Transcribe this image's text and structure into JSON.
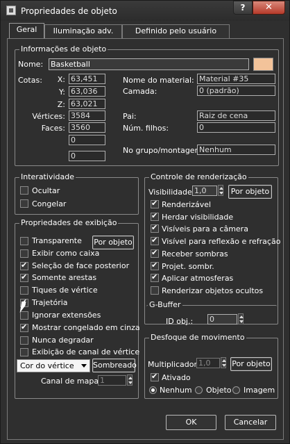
{
  "window": {
    "title": "Propriedades de objeto",
    "help": "?",
    "close": "✕"
  },
  "tabs": [
    {
      "label": "Geral"
    },
    {
      "label": "Iluminação adv."
    },
    {
      "label": "Definido pelo usuário"
    }
  ],
  "info": {
    "title": "Informações de objeto",
    "name_label": "Nome:",
    "name_value": "Basketball",
    "swatch_color": "#f3c39a",
    "cotas_label": "Cotas:",
    "x_label": "X:",
    "x_value": "63,451",
    "y_label": "Y:",
    "y_value": "63,036",
    "z_label": "Z:",
    "z_value": "63,021",
    "vertices_label": "Vértices:",
    "vertices_value": "3584",
    "faces_label": "Faces:",
    "faces_value": "3560",
    "extra1_value": "0",
    "extra2_value": "0",
    "material_label": "Nome do material:",
    "material_value": "Material #35",
    "camada_label": "Camada:",
    "camada_value": "0 (padrão)",
    "pai_label": "Pai:",
    "pai_value": "Raiz de cena",
    "filhos_label": "Núm. filhos:",
    "filhos_value": "0",
    "grupo_label": "No grupo/montagem:",
    "grupo_value": "Nenhum"
  },
  "interatividade": {
    "title": "Interatividade",
    "items": [
      {
        "label": "Ocultar",
        "checked": false
      },
      {
        "label": "Congelar",
        "checked": false
      }
    ]
  },
  "exibicao": {
    "title": "Propriedades de exibição",
    "por_objeto": "Por objeto",
    "items": [
      {
        "label": "Transparente",
        "checked": false
      },
      {
        "label": "Exibir como caixa",
        "checked": false
      },
      {
        "label": "Seleção de face posterior",
        "checked": true
      },
      {
        "label": "Somente arestas",
        "checked": true
      },
      {
        "label": "Tiques de vértice",
        "checked": false
      },
      {
        "label": "Trajetória",
        "checked": true
      },
      {
        "label": "Ignorar extensões",
        "checked": false
      },
      {
        "label": "Mostrar congelado em cinza",
        "checked": true
      },
      {
        "label": "Nunca degradar",
        "checked": false
      },
      {
        "label": "Exibição de canal de vértice",
        "checked": false
      }
    ],
    "dropdown_value": "Cor do vértice",
    "sombreado": "Sombreado",
    "canal_label": "Canal de mapa:",
    "canal_value": "1"
  },
  "renderizacao": {
    "title": "Controle de renderização",
    "visibilidade_label": "Visibilidade:",
    "visibilidade_value": "1,0",
    "por_objeto": "Por objeto",
    "items": [
      {
        "label": "Renderizável",
        "checked": true
      },
      {
        "label": "Herdar visibilidade",
        "checked": true
      },
      {
        "label": "Visíveis para a câmera",
        "checked": true
      },
      {
        "label": "Visível para reflexão e refração",
        "checked": true
      },
      {
        "label": "Receber sombras",
        "checked": true
      },
      {
        "label": "Projet. sombr.",
        "checked": true
      },
      {
        "label": "Aplicar atmosferas",
        "checked": true
      },
      {
        "label": "Renderizar objetos ocultos",
        "checked": false
      }
    ]
  },
  "gbuffer": {
    "title": "G-Buffer",
    "id_label": "ID obj.:",
    "id_value": "0"
  },
  "desfoque": {
    "title": "Desfoque de movimento",
    "mult_label": "Multiplicador:",
    "mult_value": "1,0",
    "por_objeto": "Por objeto",
    "ativado_label": "Ativado",
    "ativado_checked": true,
    "radios": [
      {
        "label": "Nenhum",
        "selected": true
      },
      {
        "label": "Objeto",
        "selected": false
      },
      {
        "label": "Imagem",
        "selected": false
      }
    ]
  },
  "footer": {
    "ok": "OK",
    "cancel": "Cancelar"
  }
}
